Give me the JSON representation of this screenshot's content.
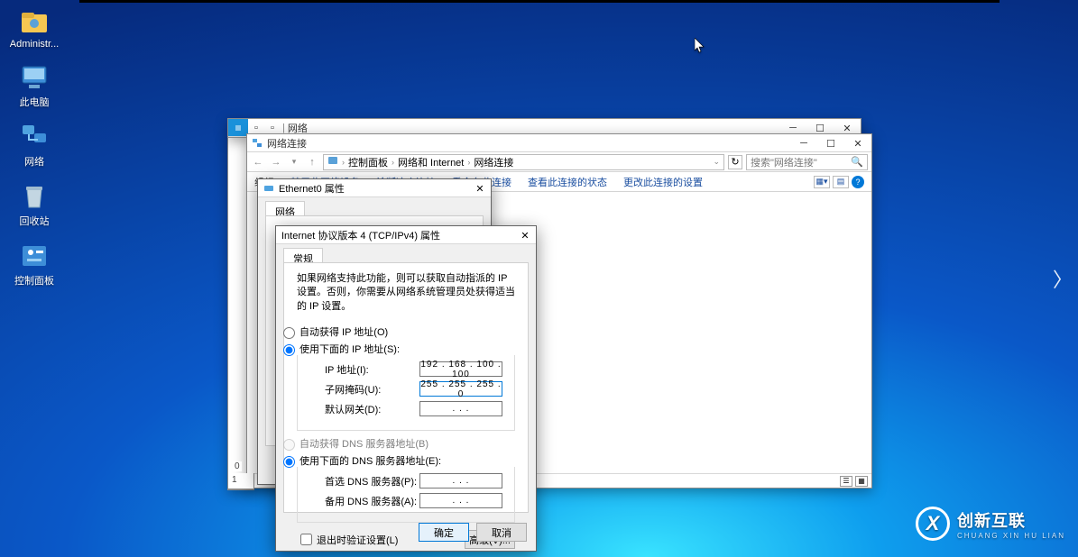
{
  "desktop": {
    "icons": [
      {
        "name": "administrator",
        "label": "Administr..."
      },
      {
        "name": "this-pc",
        "label": "此电脑"
      },
      {
        "name": "network",
        "label": "网络"
      },
      {
        "name": "recycle-bin",
        "label": "回收站"
      },
      {
        "name": "control-panel",
        "label": "控制面板"
      }
    ]
  },
  "explorer1": {
    "title": "网络"
  },
  "explorer2": {
    "title": "网络连接",
    "breadcrumbs": [
      "控制面板",
      "网络和 Internet",
      "网络连接"
    ],
    "search_placeholder": "搜索\"网络连接\"",
    "cmds": [
      "组织",
      "禁用此网络设备",
      "诊断这个连接",
      "重命名此连接",
      "查看此连接的状态",
      "更改此连接的设置"
    ]
  },
  "eth_dialog": {
    "title": "Ethernet0 属性",
    "tab": "网络"
  },
  "ipv4": {
    "title": "Internet 协议版本 4 (TCP/IPv4) 属性",
    "tab": "常规",
    "desc": "如果网络支持此功能，则可以获取自动指派的 IP 设置。否则，你需要从网络系统管理员处获得适当的 IP 设置。",
    "auto_ip": "自动获得 IP 地址(O)",
    "use_ip": "使用下面的 IP 地址(S):",
    "ip_label": "IP 地址(I):",
    "ip_value": "192 . 168 . 100 . 100",
    "mask_label": "子网掩码(U):",
    "mask_value": "255 . 255 . 255 .  0",
    "gw_label": "默认网关(D):",
    "gw_value": " .     .     . ",
    "auto_dns": "自动获得 DNS 服务器地址(B)",
    "use_dns": "使用下面的 DNS 服务器地址(E):",
    "dns1_label": "首选 DNS 服务器(P):",
    "dns2_label": "备用 DNS 服务器(A):",
    "dns_blank": " .     .     . ",
    "validate": "退出时验证设置(L)",
    "advanced": "高级(V)...",
    "ok": "确定",
    "cancel": "取消"
  },
  "watermark": {
    "brand": "创新互联",
    "sub": "CHUANG XIN HU LIAN"
  }
}
